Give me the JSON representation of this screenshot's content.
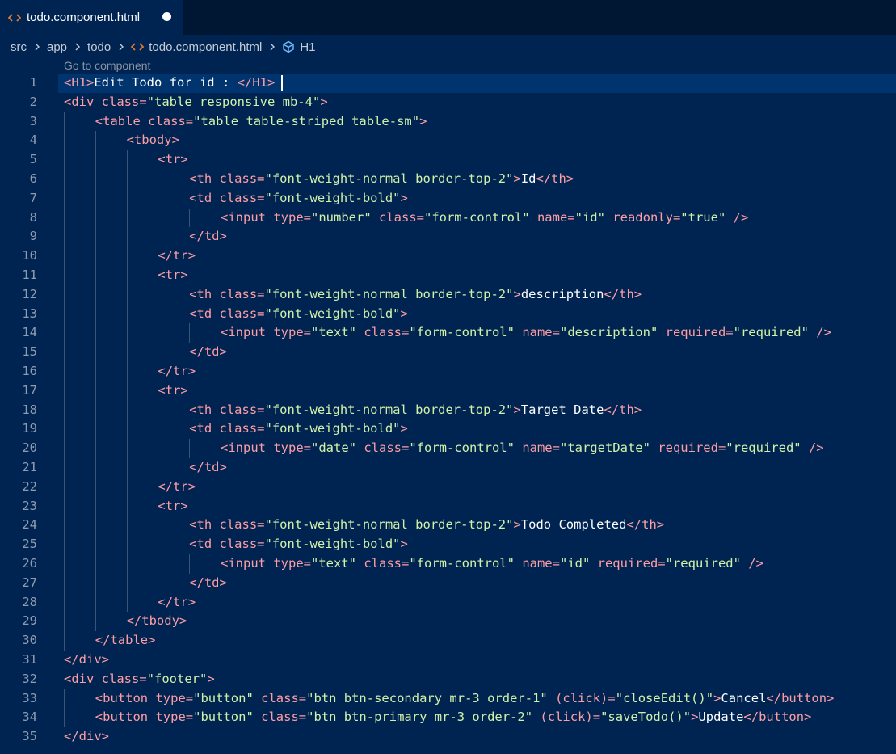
{
  "tab": {
    "label": "todo.component.html",
    "icon": "html-file-icon",
    "dirty": true
  },
  "breadcrumb": {
    "items": [
      "src",
      "app",
      "todo",
      "todo.component.html",
      "H1"
    ]
  },
  "codelens": "Go to component",
  "colors": {
    "background": "#002451",
    "tag": "#ff9da4",
    "attr_value": "#d1f1a9",
    "text": "#ffffff"
  },
  "code_lines": [
    {
      "n": "1",
      "indent": 0,
      "tokens": [
        [
          "t",
          "<H1>"
        ],
        [
          "x",
          "Edit Todo for id : "
        ],
        [
          "t",
          "</H1>"
        ]
      ]
    },
    {
      "n": "2",
      "indent": 0,
      "tokens": [
        [
          "t",
          "<div "
        ],
        [
          "a",
          "class="
        ],
        [
          "v",
          "\"table responsive mb-4\""
        ],
        [
          "t",
          ">"
        ]
      ]
    },
    {
      "n": "3",
      "indent": 1,
      "tokens": [
        [
          "t",
          "<table "
        ],
        [
          "a",
          "class="
        ],
        [
          "v",
          "\"table table-striped table-sm\""
        ],
        [
          "t",
          ">"
        ]
      ]
    },
    {
      "n": "4",
      "indent": 2,
      "tokens": [
        [
          "t",
          "<tbody>"
        ]
      ]
    },
    {
      "n": "5",
      "indent": 3,
      "tokens": [
        [
          "t",
          "<tr>"
        ]
      ]
    },
    {
      "n": "6",
      "indent": 4,
      "tokens": [
        [
          "t",
          "<th "
        ],
        [
          "a",
          "class="
        ],
        [
          "v",
          "\"font-weight-normal border-top-2\""
        ],
        [
          "t",
          ">"
        ],
        [
          "x",
          "Id"
        ],
        [
          "t",
          "</th>"
        ]
      ]
    },
    {
      "n": "7",
      "indent": 4,
      "tokens": [
        [
          "t",
          "<td "
        ],
        [
          "a",
          "class="
        ],
        [
          "v",
          "\"font-weight-bold\""
        ],
        [
          "t",
          ">"
        ]
      ]
    },
    {
      "n": "8",
      "indent": 5,
      "tokens": [
        [
          "t",
          "<input "
        ],
        [
          "a",
          "type="
        ],
        [
          "v",
          "\"number\""
        ],
        [
          "a",
          " class="
        ],
        [
          "v",
          "\"form-control\""
        ],
        [
          "a",
          " name="
        ],
        [
          "v",
          "\"id\""
        ],
        [
          "a",
          " readonly="
        ],
        [
          "v",
          "\"true\""
        ],
        [
          "t",
          " />"
        ]
      ]
    },
    {
      "n": "9",
      "indent": 4,
      "tokens": [
        [
          "t",
          "</td>"
        ]
      ]
    },
    {
      "n": "10",
      "indent": 3,
      "tokens": [
        [
          "t",
          "</tr>"
        ]
      ]
    },
    {
      "n": "11",
      "indent": 3,
      "tokens": [
        [
          "t",
          "<tr>"
        ]
      ]
    },
    {
      "n": "12",
      "indent": 4,
      "tokens": [
        [
          "t",
          "<th "
        ],
        [
          "a",
          "class="
        ],
        [
          "v",
          "\"font-weight-normal border-top-2\""
        ],
        [
          "t",
          ">"
        ],
        [
          "x",
          "description"
        ],
        [
          "t",
          "</th>"
        ]
      ]
    },
    {
      "n": "13",
      "indent": 4,
      "tokens": [
        [
          "t",
          "<td "
        ],
        [
          "a",
          "class="
        ],
        [
          "v",
          "\"font-weight-bold\""
        ],
        [
          "t",
          ">"
        ]
      ]
    },
    {
      "n": "14",
      "indent": 5,
      "tokens": [
        [
          "t",
          "<input "
        ],
        [
          "a",
          "type="
        ],
        [
          "v",
          "\"text\""
        ],
        [
          "a",
          " class="
        ],
        [
          "v",
          "\"form-control\""
        ],
        [
          "a",
          " name="
        ],
        [
          "v",
          "\"description\""
        ],
        [
          "a",
          " required="
        ],
        [
          "v",
          "\"required\""
        ],
        [
          "t",
          " />"
        ]
      ]
    },
    {
      "n": "15",
      "indent": 4,
      "tokens": [
        [
          "t",
          "</td>"
        ]
      ]
    },
    {
      "n": "16",
      "indent": 3,
      "tokens": [
        [
          "t",
          "</tr>"
        ]
      ]
    },
    {
      "n": "17",
      "indent": 3,
      "tokens": [
        [
          "t",
          "<tr>"
        ]
      ]
    },
    {
      "n": "18",
      "indent": 4,
      "tokens": [
        [
          "t",
          "<th "
        ],
        [
          "a",
          "class="
        ],
        [
          "v",
          "\"font-weight-normal border-top-2\""
        ],
        [
          "t",
          ">"
        ],
        [
          "x",
          "Target Date"
        ],
        [
          "t",
          "</th>"
        ]
      ]
    },
    {
      "n": "19",
      "indent": 4,
      "tokens": [
        [
          "t",
          "<td "
        ],
        [
          "a",
          "class="
        ],
        [
          "v",
          "\"font-weight-bold\""
        ],
        [
          "t",
          ">"
        ]
      ]
    },
    {
      "n": "20",
      "indent": 5,
      "tokens": [
        [
          "t",
          "<input "
        ],
        [
          "a",
          "type="
        ],
        [
          "v",
          "\"date\""
        ],
        [
          "a",
          " class="
        ],
        [
          "v",
          "\"form-control\""
        ],
        [
          "a",
          " name="
        ],
        [
          "v",
          "\"targetDate\""
        ],
        [
          "a",
          " required="
        ],
        [
          "v",
          "\"required\""
        ],
        [
          "t",
          " />"
        ]
      ]
    },
    {
      "n": "21",
      "indent": 4,
      "tokens": [
        [
          "t",
          "</td>"
        ]
      ]
    },
    {
      "n": "22",
      "indent": 3,
      "tokens": [
        [
          "t",
          "</tr>"
        ]
      ]
    },
    {
      "n": "23",
      "indent": 3,
      "tokens": [
        [
          "t",
          "<tr>"
        ]
      ]
    },
    {
      "n": "24",
      "indent": 4,
      "tokens": [
        [
          "t",
          "<th "
        ],
        [
          "a",
          "class="
        ],
        [
          "v",
          "\"font-weight-normal border-top-2\""
        ],
        [
          "t",
          ">"
        ],
        [
          "x",
          "Todo Completed"
        ],
        [
          "t",
          "</th>"
        ]
      ]
    },
    {
      "n": "25",
      "indent": 4,
      "tokens": [
        [
          "t",
          "<td "
        ],
        [
          "a",
          "class="
        ],
        [
          "v",
          "\"font-weight-bold\""
        ],
        [
          "t",
          ">"
        ]
      ]
    },
    {
      "n": "26",
      "indent": 5,
      "tokens": [
        [
          "t",
          "<input "
        ],
        [
          "a",
          "type="
        ],
        [
          "v",
          "\"text\""
        ],
        [
          "a",
          " class="
        ],
        [
          "v",
          "\"form-control\""
        ],
        [
          "a",
          " name="
        ],
        [
          "v",
          "\"id\""
        ],
        [
          "a",
          " required="
        ],
        [
          "v",
          "\"required\""
        ],
        [
          "t",
          " />"
        ]
      ]
    },
    {
      "n": "27",
      "indent": 4,
      "tokens": [
        [
          "t",
          "</td>"
        ]
      ]
    },
    {
      "n": "28",
      "indent": 3,
      "tokens": [
        [
          "t",
          "</tr>"
        ]
      ]
    },
    {
      "n": "29",
      "indent": 2,
      "tokens": [
        [
          "t",
          "</tbody>"
        ]
      ]
    },
    {
      "n": "30",
      "indent": 1,
      "tokens": [
        [
          "t",
          "</table>"
        ]
      ]
    },
    {
      "n": "31",
      "indent": 0,
      "tokens": [
        [
          "t",
          "</div>"
        ]
      ]
    },
    {
      "n": "32",
      "indent": 0,
      "tokens": [
        [
          "t",
          "<div "
        ],
        [
          "a",
          "class="
        ],
        [
          "v",
          "\"footer\""
        ],
        [
          "t",
          ">"
        ]
      ]
    },
    {
      "n": "33",
      "indent": 1,
      "tokens": [
        [
          "t",
          "<button "
        ],
        [
          "a",
          "type="
        ],
        [
          "v",
          "\"button\""
        ],
        [
          "a",
          " class="
        ],
        [
          "v",
          "\"btn btn-secondary mr-3 order-1\""
        ],
        [
          "a",
          " (click)="
        ],
        [
          "v",
          "\"closeEdit()\""
        ],
        [
          "t",
          ">"
        ],
        [
          "x",
          "Cancel"
        ],
        [
          "t",
          "</button>"
        ]
      ]
    },
    {
      "n": "34",
      "indent": 1,
      "tokens": [
        [
          "t",
          "<button "
        ],
        [
          "a",
          "type="
        ],
        [
          "v",
          "\"button\""
        ],
        [
          "a",
          " class="
        ],
        [
          "v",
          "\"btn btn-primary mr-3 order-2\""
        ],
        [
          "a",
          " (click)="
        ],
        [
          "v",
          "\"saveTodo()\""
        ],
        [
          "t",
          ">"
        ],
        [
          "x",
          "Update"
        ],
        [
          "t",
          "</button>"
        ]
      ]
    },
    {
      "n": "35",
      "indent": 0,
      "tokens": [
        [
          "t",
          "</div>"
        ]
      ]
    }
  ]
}
